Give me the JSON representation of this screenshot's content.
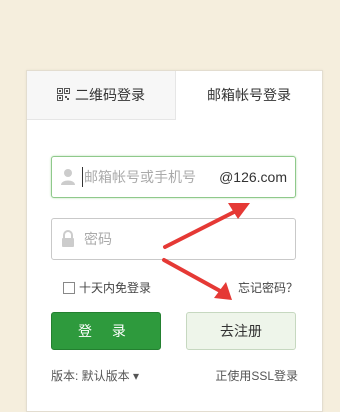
{
  "tabs": {
    "qr_label": "二维码登录",
    "mail_label": "邮箱帐号登录"
  },
  "form": {
    "username_placeholder": "邮箱帐号或手机号",
    "domain_suffix": "@126.com",
    "password_placeholder": "密码",
    "remember_label": "十天内免登录",
    "forgot_label": "忘记密码？",
    "login_label": "登 录",
    "register_label": "去注册"
  },
  "footer": {
    "version_label": "版本: 默认版本 ▾",
    "ssl_label": "正使用SSL登录"
  },
  "colors": {
    "accent": "#2e9a3d",
    "arrow": "#e53935"
  }
}
